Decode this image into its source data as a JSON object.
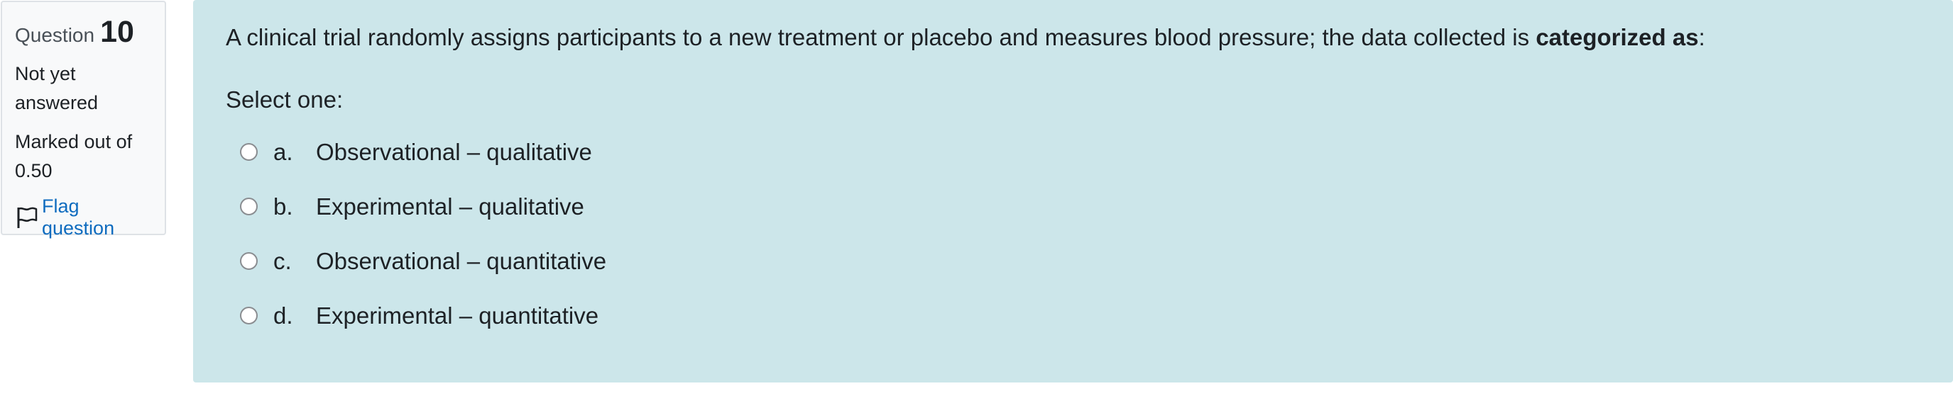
{
  "info": {
    "question_word": "Question",
    "question_number": "10",
    "state": "Not yet answered",
    "grade": "Marked out of 0.50",
    "flag_label": "Flag question",
    "flag_icon": "flag-outline-icon",
    "link_color": "#0f6cbf"
  },
  "question": {
    "text_before": "A clinical trial randomly assigns participants to a new treatment or placebo and measures blood pressure; the data collected is ",
    "text_bold": "categorized as",
    "text_after": ":",
    "prompt": "Select one:",
    "background_color": "#cce6ea",
    "options": [
      {
        "letter": "a.",
        "label": "Observational – qualitative",
        "selected": false
      },
      {
        "letter": "b.",
        "label": "Experimental – qualitative",
        "selected": false
      },
      {
        "letter": "c.",
        "label": "Observational – quantitative",
        "selected": false
      },
      {
        "letter": "d.",
        "label": "Experimental – quantitative",
        "selected": false
      }
    ]
  }
}
